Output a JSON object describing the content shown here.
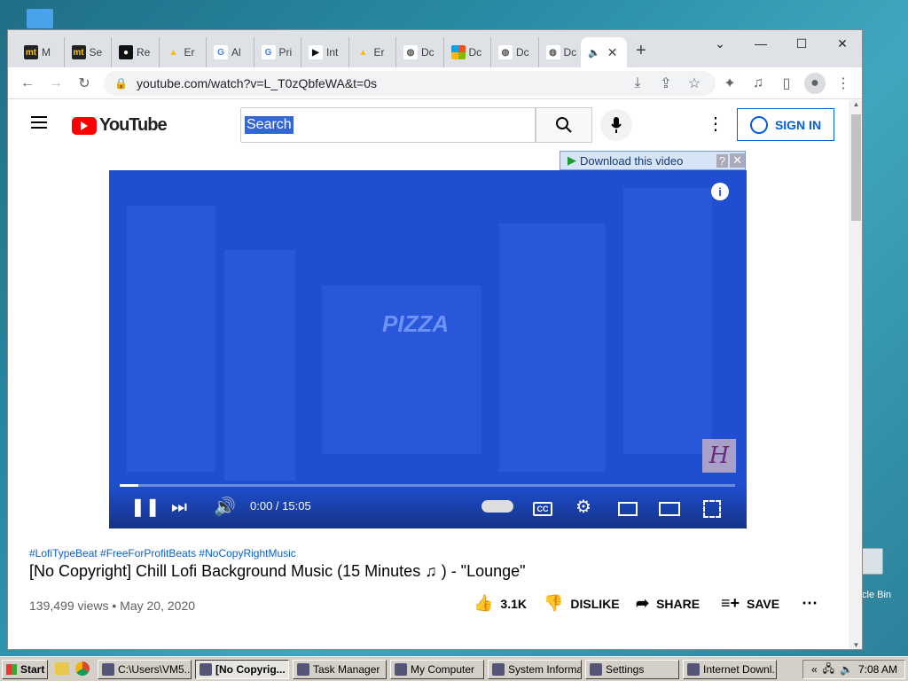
{
  "desktop": {
    "recycle_label": "cle Bin"
  },
  "browser": {
    "tabs": [
      {
        "label": "M",
        "fav": "mt",
        "color": "#222"
      },
      {
        "label": "Se",
        "fav": "mt",
        "color": "#222"
      },
      {
        "label": "Re",
        "fav": "github-icon",
        "color": "#111"
      },
      {
        "label": "Er",
        "fav": "drive-icon",
        "color": "#1a73e8"
      },
      {
        "label": "Al",
        "fav": "google-icon",
        "color": "#fff"
      },
      {
        "label": "Pri",
        "fav": "google-icon",
        "color": "#fff"
      },
      {
        "label": "Int",
        "fav": "play-icon",
        "color": "#fff"
      },
      {
        "label": "Er",
        "fav": "drive-icon",
        "color": "#1a73e8"
      },
      {
        "label": "Dc",
        "fav": "globe-icon",
        "color": "#fff"
      },
      {
        "label": "Dc",
        "fav": "microsoft-icon",
        "color": "#fff"
      },
      {
        "label": "Dc",
        "fav": "globe-icon",
        "color": "#fff"
      },
      {
        "label": "Dc",
        "fav": "globe-icon",
        "color": "#fff"
      }
    ],
    "url": "youtube.com/watch?v=L_T0zQbfeWA&t=0s"
  },
  "youtube": {
    "logo_text": "YouTube",
    "search_value": "Search",
    "sign_in": "SIGN IN",
    "download_bar": "Download this video",
    "video_text": "PIZZA",
    "watermark": "H",
    "time": "0:00 / 15:05",
    "hashtags": "#LofiTypeBeat #FreeForProfitBeats #NoCopyRightMusic",
    "title": "[No Copyright] Chill Lofi Background Music (15 Minutes ♫ ) - \"Lounge\"",
    "views": "139,499 views • May 20, 2020",
    "likes": "3.1K",
    "dislike": "DISLIKE",
    "share": "SHARE",
    "save": "SAVE",
    "accent": "#ff0000",
    "link_color": "#065fd4"
  },
  "taskbar": {
    "start": "Start",
    "buttons": [
      "C:\\Users\\VM5...",
      "[No Copyrig...",
      "Task Manager",
      "My Computer",
      "System Informa...",
      "Settings",
      "Internet Downl..."
    ],
    "clock": "7:08 AM"
  }
}
